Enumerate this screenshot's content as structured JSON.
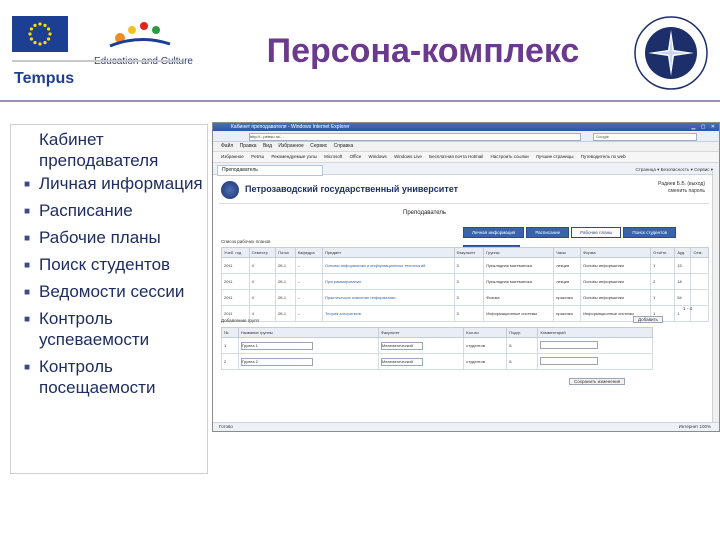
{
  "slide": {
    "title": "Персона-комплекс",
    "colors": {
      "title": "#6a3a8f",
      "text": "#1f2d62",
      "rule": "#9c8fbf"
    }
  },
  "logos": {
    "education_culture": "Education and Culture",
    "tempus": "Tempus"
  },
  "panel": {
    "heading": "Кабинет преподавателя",
    "items": [
      "Личная информация",
      "Расписание",
      "Рабочие планы",
      "Поиск студентов",
      "Ведомости сессии",
      "Контроль успеваемости",
      "Контроль посещаемости"
    ]
  },
  "browser": {
    "window_title": "Кабинет преподавателя - Windows Internet Explorer",
    "url": "http://...petrsu.ru/...",
    "search_placeholder": "Google",
    "menu": [
      "Файл",
      "Правка",
      "Вид",
      "Избранное",
      "Сервис",
      "Справка"
    ],
    "favorites": [
      "Избранное",
      "Petrsu",
      "Рекомендуемые узлы",
      "Microsoft",
      "Office",
      "Windows",
      "Windows Live",
      "Бесплатная почта Hotmail",
      "Настроить ссылки",
      "Лучшие страницы",
      "Путеводитель по web"
    ],
    "tab_label": "Преподаватель",
    "tools": "Страница ▾  Безопасность ▾  Сервис ▾",
    "status_left": "Готово",
    "status_right": "Интернет   100%",
    "site": {
      "name": "Петрозаводский государственный университет",
      "user_line1": "Радиев Б.Б. (выход)",
      "user_line2": "сменить пароль",
      "role": "Преподаватель",
      "nav": [
        "Личная информация",
        "Расписание",
        "Рабочие планы",
        "Поиск студентов",
        "Ведомости сессии"
      ],
      "nav_active_index": 2,
      "plans_label": "Список рабочих планов",
      "pager": "1 - 4",
      "plan_columns": [
        "Учеб. год",
        "Семестр",
        "Поток",
        "Кафедра",
        "Предмет",
        "Факультет",
        "Группы",
        "Часы",
        "Форма",
        "Отчётн.",
        "Ауд.",
        "Сем."
      ],
      "plans": [
        [
          "2011",
          "4",
          "05-1",
          "–",
          "Основы информатики и информационных технологий",
          "3",
          "Прикладная математика",
          "лекция",
          "Основы информатики",
          "1",
          "15",
          ""
        ],
        [
          "2011",
          "4",
          "05-1",
          "–",
          "Программирование",
          "3",
          "Прикладная математика",
          "лекция",
          "Основы информатики",
          "2",
          "18",
          ""
        ],
        [
          "2011",
          "4",
          "05-1",
          "–",
          "Практическое освоение информатики",
          "3",
          "Физика",
          "практика",
          "Основы информатики",
          "1",
          "54",
          ""
        ],
        [
          "2011",
          "4",
          "05-1",
          "–",
          "Теория алгоритмов",
          "3",
          "Информационные системы",
          "практика",
          "Информационные системы",
          "1",
          "1",
          ""
        ]
      ],
      "edit_label": "Добавление групп",
      "add_button": "Добавить",
      "edit_columns": [
        "№",
        "Название группы",
        "Факультет",
        "Кол-во",
        "Подгр.",
        "Комментарий"
      ],
      "edit_rows": [
        [
          "1",
          "Группа 1",
          "Математический",
          "студентов",
          "8",
          ""
        ],
        [
          "2",
          "Группа 2",
          "Математический",
          "студентов",
          "8",
          ""
        ]
      ],
      "save_button": "Сохранить изменения"
    }
  }
}
